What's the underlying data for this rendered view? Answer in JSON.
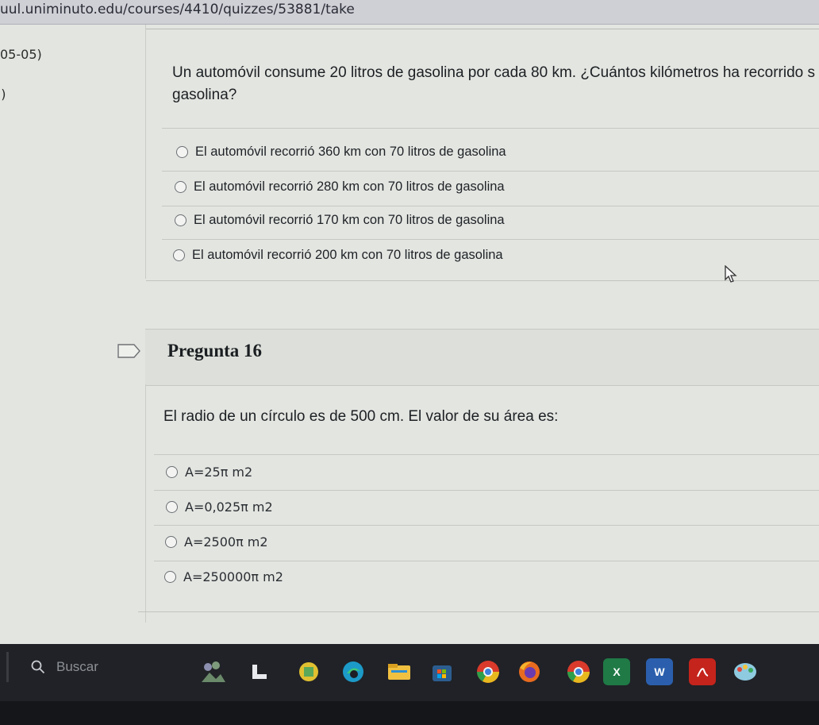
{
  "browser": {
    "url": "uul.uniminuto.edu/courses/4410/quizzes/53881/take"
  },
  "sidebar": {
    "date_fragment": "05-05)",
    "marker": " )"
  },
  "question_prev": {
    "text_line1": "Un automóvil consume 20 litros de gasolina por cada 80 km. ¿Cuántos kilómetros ha recorrido s",
    "text_line2": "gasolina?",
    "answers": [
      "El automóvil recorrió 360 km con 70 litros de gasolina",
      "El automóvil recorrió 280 km con 70 litros de gasolina",
      "El automóvil recorrió 170 km con 70 litros de gasolina",
      "El automóvil recorrió 200 km con 70 litros de gasolina"
    ]
  },
  "question_16": {
    "title": "Pregunta 16",
    "text": "El radio de un círculo es de 500 cm. El valor de su área es:",
    "answers": [
      "A=25π m2",
      "A=0,025π m2",
      "A=2500π m2",
      "A=250000π m2"
    ]
  },
  "taskbar": {
    "search_placeholder": "Buscar",
    "icons": [
      "landscape-app-icon",
      "task-view-icon",
      "folder-icon",
      "edge-icon",
      "file-explorer-icon",
      "store-icon",
      "chrome-icon",
      "firefox-icon",
      "chrome-2-icon",
      "excel-icon",
      "word-icon",
      "acrobat-icon",
      "paint-icon"
    ],
    "excel_letter": "X",
    "word_letter": "W"
  },
  "colors": {
    "page_bg": "#e3e5e1",
    "taskbar_bg": "#1d1f24",
    "urlbar_bg": "#cfd0d6"
  }
}
